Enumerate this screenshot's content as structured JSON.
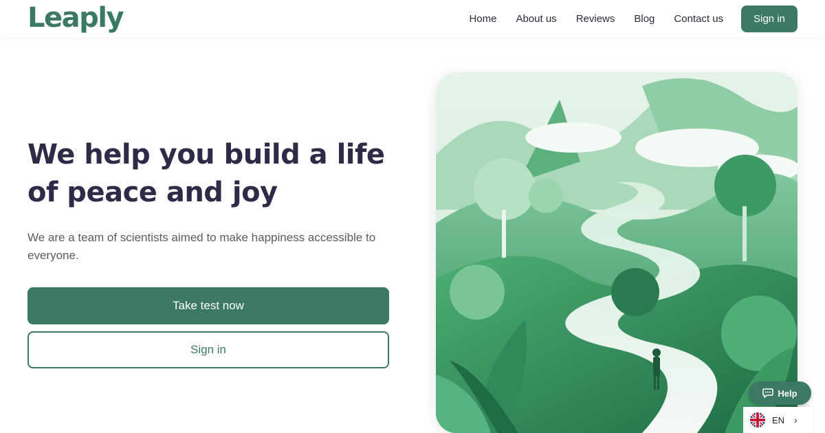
{
  "header": {
    "logo": "Leaply",
    "nav": [
      "Home",
      "About us",
      "Reviews",
      "Blog",
      "Contact us"
    ],
    "signin_label": "Sign in"
  },
  "hero": {
    "title": "We help you build a life of peace and joy",
    "subtitle": "We are a team of scientists aimed to make happiness accessible to everyone.",
    "primary_cta": "Take test now",
    "secondary_cta": "Sign in"
  },
  "widgets": {
    "help_label": "Help",
    "language_code": "EN",
    "language_flag": "uk-flag-icon"
  },
  "colors": {
    "brand": "#3b7966",
    "title": "#2f2a48"
  }
}
